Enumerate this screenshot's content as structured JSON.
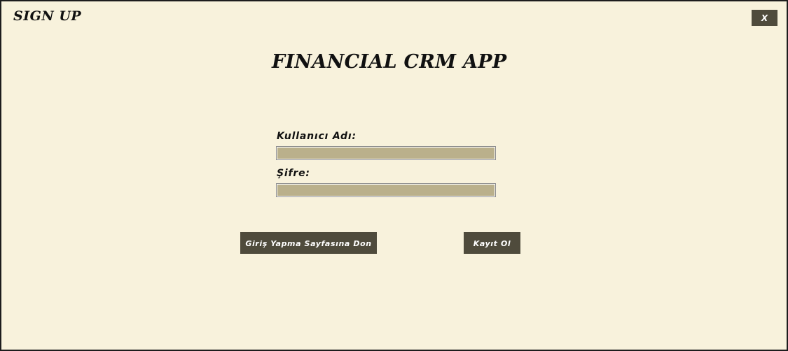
{
  "window": {
    "title": "SIGN UP",
    "close_label": "X"
  },
  "app": {
    "heading": "FINANCIAL CRM APP"
  },
  "form": {
    "username": {
      "label": "Kullanıcı Adı:",
      "value": ""
    },
    "password": {
      "label": "Şifre:",
      "value": ""
    }
  },
  "actions": {
    "back_to_login_label": "Giriş Yapma Sayfasına Don",
    "register_label": "Kayıt Ol"
  },
  "colors": {
    "background": "#f8f2dc",
    "button": "#4f4b3c",
    "field": "#bab08b",
    "text": "#111111"
  }
}
